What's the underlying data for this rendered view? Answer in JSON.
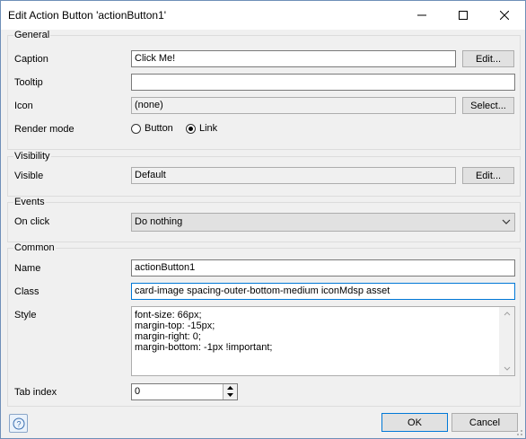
{
  "window": {
    "title": "Edit Action Button 'actionButton1'"
  },
  "general": {
    "title": "General",
    "caption_label": "Caption",
    "caption_value": "Click Me!",
    "caption_edit": "Edit...",
    "tooltip_label": "Tooltip",
    "tooltip_value": "",
    "icon_label": "Icon",
    "icon_value": "(none)",
    "icon_select": "Select...",
    "render_mode_label": "Render mode",
    "render_mode_options": [
      "Button",
      "Link"
    ],
    "render_mode_selected": "Link"
  },
  "visibility": {
    "title": "Visibility",
    "visible_label": "Visible",
    "visible_value": "Default",
    "visible_edit": "Edit..."
  },
  "events": {
    "title": "Events",
    "onclick_label": "On click",
    "onclick_value": "Do nothing"
  },
  "common": {
    "title": "Common",
    "name_label": "Name",
    "name_value": "actionButton1",
    "class_label": "Class",
    "class_value": "card-image spacing-outer-bottom-medium iconMdsp asset",
    "style_label": "Style",
    "style_lines": [
      "font-size: 66px;",
      "margin-top: -15px;",
      "margin-right: 0;",
      "margin-bottom: -1px !important;"
    ],
    "tabindex_label": "Tab index",
    "tabindex_value": "0"
  },
  "footer": {
    "ok": "OK",
    "cancel": "Cancel"
  }
}
